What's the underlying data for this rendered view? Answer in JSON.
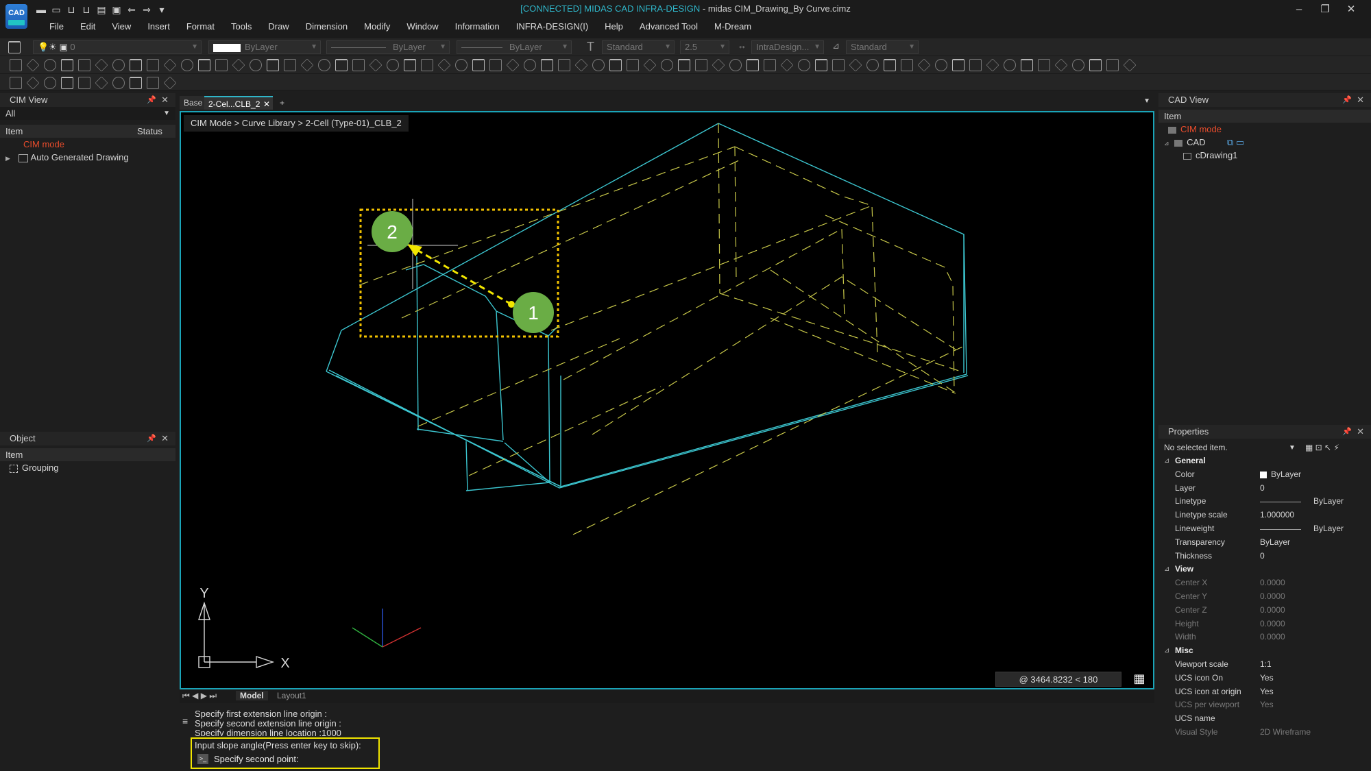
{
  "window": {
    "status": "[CONNECTED] MIDAS CAD INFRA-DESIGN",
    "title": " - midas CIM_Drawing_By Curve.cimz",
    "logo_text": "CAD"
  },
  "menu": [
    "File",
    "Edit",
    "View",
    "Insert",
    "Format",
    "Tools",
    "Draw",
    "Dimension",
    "Modify",
    "Window",
    "Information",
    "INFRA-DESIGN(I)",
    "Help",
    "Advanced Tool",
    "M-Dream"
  ],
  "toolbar": {
    "layer_value": "0",
    "color_value": "ByLayer",
    "linetype_value": "ByLayer",
    "lineweight_value": "ByLayer",
    "textstyle_value": "Standard",
    "textheight_value": "2.5",
    "dimstyle_value": "IntraDesign...",
    "tablestyle_value": "Standard"
  },
  "cim_view": {
    "title": "CIM View",
    "filter": "All",
    "col_item": "Item",
    "col_status": "Status",
    "items": [
      "CIM mode",
      "Auto Generated Drawing"
    ]
  },
  "object_panel": {
    "title": "Object",
    "col_item": "Item",
    "items": [
      "Grouping"
    ]
  },
  "tabs": {
    "base": "Base",
    "active": "2-Cel...CLB_2",
    "add": "+"
  },
  "viewport": {
    "breadcrumb": "CIM Mode > Curve Library > 2-Cell (Type-01)_CLB_2",
    "coordinate": "@  3464.8232 < 180",
    "ucs_x": "X",
    "ucs_y": "Y",
    "marker_1": "1",
    "marker_2": "2"
  },
  "layout_tabs": {
    "model": "Model",
    "layout1": "Layout1"
  },
  "command": {
    "history": [
      "Specify first extension line origin :",
      "Specify second extension line origin :",
      "Specify dimension line location :1000",
      "Input slope angle(Press enter key to skip):"
    ],
    "prompt": "Specify second point:"
  },
  "cad_view": {
    "title": "CAD View",
    "col_item": "Item",
    "items": [
      "CIM mode",
      "CAD",
      "cDrawing1"
    ]
  },
  "properties": {
    "title": "Properties",
    "selection": "No selected item.",
    "sections": [
      {
        "name": "General",
        "rows": [
          {
            "k": "Color",
            "v": "ByLayer"
          },
          {
            "k": "Layer",
            "v": "0"
          },
          {
            "k": "Linetype",
            "v": "ByLayer"
          },
          {
            "k": "Linetype scale",
            "v": "1.000000"
          },
          {
            "k": "Lineweight",
            "v": "ByLayer"
          },
          {
            "k": "Transparency",
            "v": "ByLayer"
          },
          {
            "k": "Thickness",
            "v": "0"
          }
        ]
      },
      {
        "name": "View",
        "rows": [
          {
            "k": "Center X",
            "v": "0.0000"
          },
          {
            "k": "Center Y",
            "v": "0.0000"
          },
          {
            "k": "Center Z",
            "v": "0.0000"
          },
          {
            "k": "Height",
            "v": "0.0000"
          },
          {
            "k": "Width",
            "v": "0.0000"
          }
        ]
      },
      {
        "name": "Misc",
        "rows": [
          {
            "k": "Viewport scale",
            "v": "1:1"
          },
          {
            "k": "UCS icon On",
            "v": "Yes"
          },
          {
            "k": "UCS icon at origin",
            "v": "Yes"
          },
          {
            "k": "UCS per viewport",
            "v": "Yes"
          },
          {
            "k": "UCS name",
            "v": ""
          },
          {
            "k": "Visual Style",
            "v": "2D Wireframe"
          }
        ]
      }
    ]
  },
  "colors": {
    "accent_cyan": "#1aa4b8",
    "model_cyan": "#3cc6d0",
    "hidden_yellow": "#c9c94a",
    "highlight_yellow": "#f2e600",
    "marker_green": "#6aad45",
    "cim_red": "#e84c2c"
  }
}
